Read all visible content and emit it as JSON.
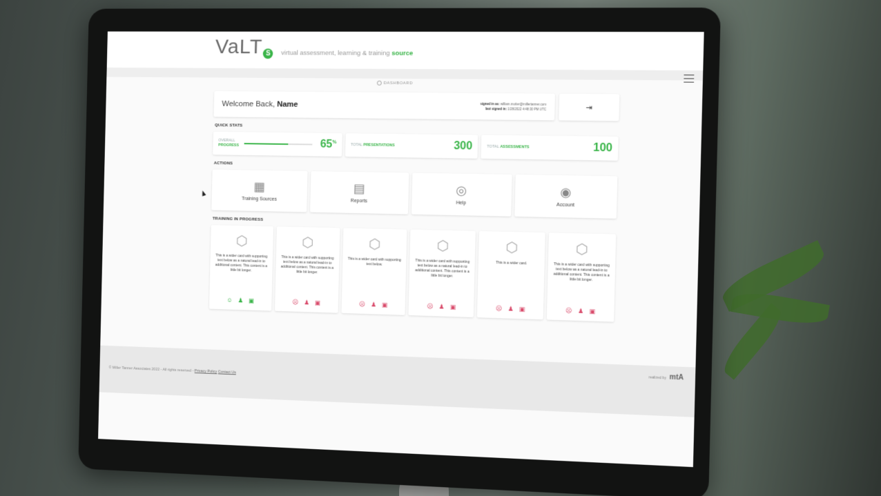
{
  "header": {
    "logo_text": "VaLT",
    "logo_badge": "S",
    "tagline_prefix": "virtual assessment, learning & training",
    "tagline_accent": "source",
    "breadcrumb": "DASHBOARD",
    "menu_icon": "hamburger-icon"
  },
  "welcome": {
    "greeting": "Welcome Back,",
    "name": "Name",
    "signed_in_label": "signed in as:",
    "signed_in_value": "william.motter@millertanner.com",
    "last_signed_label": "last signed in:",
    "last_signed_value": "1/28/2022 4:48:30 PM UTC",
    "logout_icon": "logout-icon"
  },
  "quick_stats": {
    "heading": "QUICK STATS",
    "items": [
      {
        "label_top": "OVERALL",
        "label_bold": "PROGRESS",
        "value": "65",
        "suffix": "%",
        "progress": 0.65
      },
      {
        "label_top": "TOTAL",
        "label_bold": "PRESENTATIONS",
        "value": "300"
      },
      {
        "label_top": "TOTAL",
        "label_bold": "ASSESSMENTS",
        "value": "100"
      }
    ]
  },
  "actions": {
    "heading": "ACTIONS",
    "items": [
      {
        "label": "Training Sources",
        "icon": "grid-icon"
      },
      {
        "label": "Reports",
        "icon": "bar-chart-icon"
      },
      {
        "label": "Help",
        "icon": "lifebuoy-icon"
      },
      {
        "label": "Account",
        "icon": "fingerprint-icon"
      }
    ]
  },
  "training": {
    "heading": "TRAINING IN PROGRESS",
    "cards": [
      {
        "text": "This is a wider card with supporting text below as a natural lead-in to additional content. This content is a little bit longer.",
        "status_color": "#3bb54a"
      },
      {
        "text": "This is a wider card with supporting text below as a natural lead-in to additional content. This content is a little bit longer.",
        "status_color": "#d94b6b"
      },
      {
        "text": "This is a wider card with supporting text below.",
        "status_color": "#d94b6b"
      },
      {
        "text": "This is a wider card with supporting text below as a natural lead-in to additional content. This content is a little bit longer.",
        "status_color": "#d94b6b"
      },
      {
        "text": "This is a wider card.",
        "status_color": "#d94b6b"
      },
      {
        "text": "This is a wider card with supporting text below as a natural lead-in to additional content. This content is a little bit longer.",
        "status_color": "#d94b6b"
      }
    ]
  },
  "footer": {
    "copyright": "© Miller Tanner Associates 2022 - All rights reserved -",
    "privacy": "Privacy Policy",
    "contact": "Contact Us",
    "realized_by": "realized by",
    "brand": "mtA"
  },
  "colors": {
    "accent": "#3bb54a",
    "alert": "#d94b6b"
  }
}
